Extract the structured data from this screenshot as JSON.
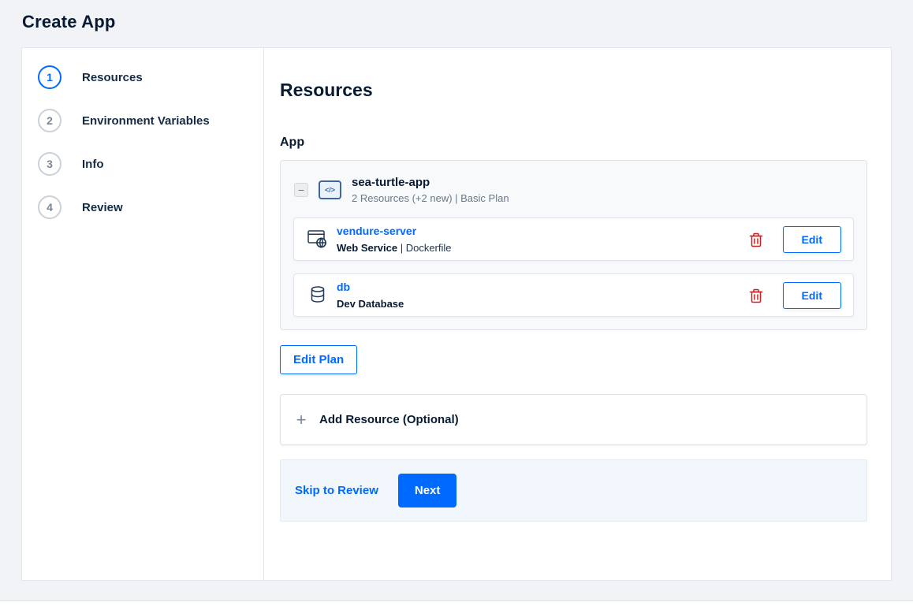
{
  "page": {
    "title": "Create App"
  },
  "stepper": {
    "active_step": 1,
    "steps": [
      {
        "number": "1",
        "label": "Resources"
      },
      {
        "number": "2",
        "label": "Environment Variables"
      },
      {
        "number": "3",
        "label": "Info"
      },
      {
        "number": "4",
        "label": "Review"
      }
    ]
  },
  "content": {
    "heading": "Resources",
    "section_label": "App",
    "app_group": {
      "name": "sea-turtle-app",
      "summary": "2 Resources (+2 new) | Basic Plan"
    },
    "resources": [
      {
        "name": "vendure-server",
        "type": "Web Service",
        "detail": " | Dockerfile",
        "edit_label": "Edit",
        "icon": "web-service-icon"
      },
      {
        "name": "db",
        "type": "Dev Database",
        "detail": "",
        "edit_label": "Edit",
        "icon": "database-icon"
      }
    ],
    "edit_plan_label": "Edit Plan",
    "add_resource_label": "Add Resource (Optional)",
    "footer": {
      "skip_label": "Skip to Review",
      "next_label": "Next"
    }
  },
  "icons": {
    "collapse_glyph": "−",
    "add_glyph": "+",
    "code_glyph": "</>"
  },
  "colors": {
    "accent_blue": "#0069ff",
    "danger_red": "#cc1f1f",
    "heading_navy": "#081b33",
    "muted_gray": "#69788c",
    "page_background": "#f1f3f6",
    "footer_bar_background": "#f1f7fd"
  }
}
